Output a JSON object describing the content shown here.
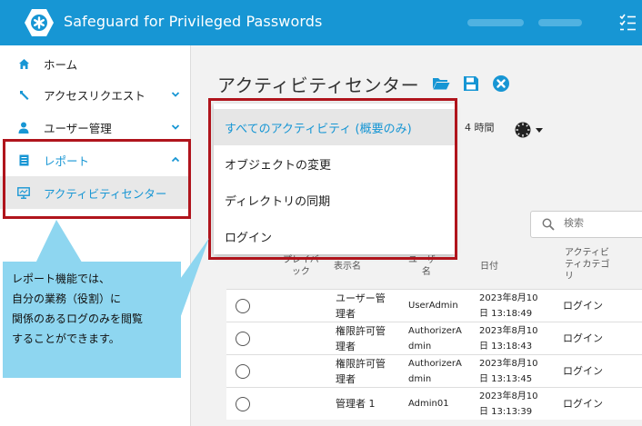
{
  "app": {
    "title": "Safeguard for Privileged Passwords",
    "brand_color": "#1796d4",
    "logo_icon": "asterisk-badge-icon"
  },
  "sidebar": {
    "items": [
      {
        "label": "ホーム",
        "icon": "home-icon"
      },
      {
        "label": "アクセスリクエスト",
        "icon": "wrench-icon",
        "chevron": "down"
      },
      {
        "label": "ユーザー管理",
        "icon": "user-icon",
        "chevron": "down"
      },
      {
        "label": "レポート",
        "icon": "document-icon",
        "chevron": "up"
      },
      {
        "label": "アクティビティセンター",
        "icon": "monitor-icon"
      }
    ]
  },
  "main": {
    "title": "アクティビティセンター",
    "filter_partial": "4 時間",
    "search_placeholder": "検索"
  },
  "dropdown": {
    "options": [
      "すべてのアクティビティ (概要のみ)",
      "オブジェクトの変更",
      "ディレクトリの同期",
      "ログイン"
    ],
    "selected_index": 0
  },
  "table": {
    "headers": {
      "playback": "プレイバ\nック",
      "display_name": "表示名",
      "user_name": "ユーザー\n名",
      "date": "日付",
      "category": "アクティビ\nティカテゴ\nリ"
    },
    "rows": [
      {
        "display_name": "ユーザー管\n理者",
        "user_name": "UserAdmin",
        "date": "2023年8月10\n日 13:18:49",
        "category": "ログイン"
      },
      {
        "display_name": "権限許可管\n理者",
        "user_name": "AuthorizerA\ndmin",
        "date": "2023年8月10\n日 13:18:43",
        "category": "ログイン"
      },
      {
        "display_name": "権限許可管\n理者",
        "user_name": "AuthorizerA\ndmin",
        "date": "2023年8月10\n日 13:13:45",
        "category": "ログイン"
      },
      {
        "display_name": "管理者 1",
        "user_name": "Admin01",
        "date": "2023年8月10\n日 13:13:39",
        "category": "ログイン"
      }
    ]
  },
  "callout": {
    "lines": [
      "レポート機能では、",
      "自分の業務（役割）に",
      "関係のあるログのみを閲覧",
      "することができます。"
    ],
    "color": "#8ed6f0"
  },
  "highlight_color": "#b0141c"
}
